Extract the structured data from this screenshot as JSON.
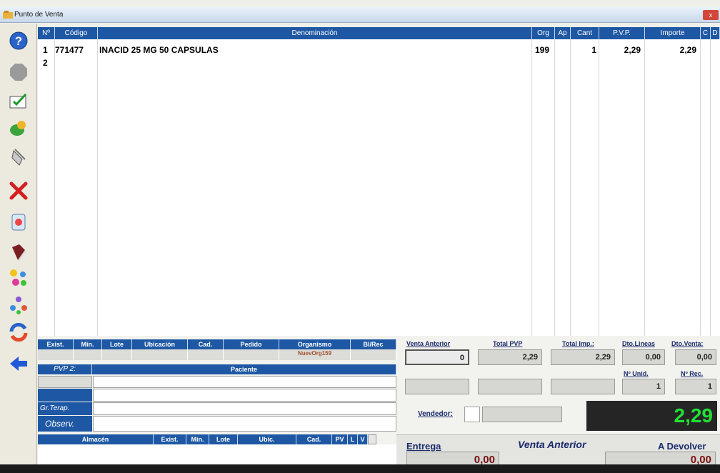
{
  "window": {
    "title": "Punto de Venta",
    "close_label": "x"
  },
  "grid": {
    "headers": [
      "Nº",
      "Código",
      "Denominación",
      "Org",
      "Ap",
      "Cant",
      "P.V.P.",
      "Importe",
      "C",
      "D"
    ],
    "rows": [
      {
        "n": "1",
        "codigo": "771477",
        "denominacion": "INACID 25 MG 50 CAPSULAS",
        "org": "199",
        "ap": "",
        "cant": "1",
        "pvp": "2,29",
        "importe": "2,29"
      },
      {
        "n": "2",
        "codigo": "",
        "denominacion": "",
        "org": "",
        "ap": "",
        "cant": "",
        "pvp": "",
        "importe": ""
      }
    ]
  },
  "stock": {
    "headers": [
      "Exist.",
      "Mín.",
      "Lote",
      "Ubicación",
      "Cad.",
      "Pedido",
      "Organismo",
      "Bl/Rec"
    ],
    "organismo_value": "NuevOrg159"
  },
  "paciente": {
    "pvp2_label": "PVP 2:",
    "paciente_label": "Paciente",
    "grterap_label": "Gr.Terap.",
    "observ_label": "Observ."
  },
  "almacen": {
    "headers": [
      "Almacén",
      "Exist.",
      "Mín.",
      "Lote",
      "Ubic.",
      "Cad.",
      "PV",
      "L",
      "V"
    ]
  },
  "totals": {
    "venta_anterior_label": "Venta Anterior",
    "venta_anterior_value": "0",
    "total_pvp_label": "Total PVP",
    "total_pvp_value": "2,29",
    "total_imp_label": "Total Imp.:",
    "total_imp_value": "2,29",
    "dto_lineas_label": "Dto.Lineas",
    "dto_lineas_value": "0,00",
    "dto_venta_label": "Dto.Venta:",
    "dto_venta_value": "0,00",
    "n_unid_label": "Nº Unid.",
    "n_unid_value": "1",
    "n_rec_label": "Nº Rec.",
    "n_rec_value": "1",
    "vendedor_label": "Vendedor:",
    "big_total": "2,29",
    "entrega_label": "Entrega",
    "entrega_value": "0,00",
    "venta_anterior_big_label": "Venta Anterior",
    "a_devolver_label": "A Devolver",
    "a_devolver_value": "0,00"
  },
  "colors": {
    "header_blue": "#1e58a4",
    "display_green": "#22e034"
  }
}
